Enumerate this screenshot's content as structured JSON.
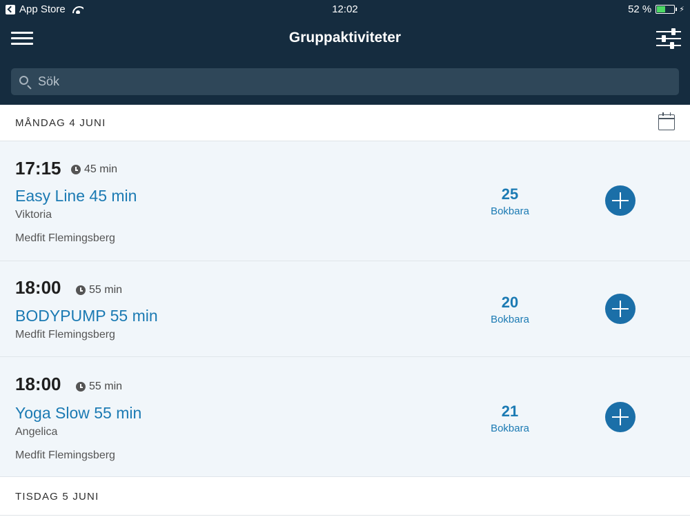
{
  "status_bar": {
    "carrier": "App Store",
    "time": "12:02",
    "battery": "52 %",
    "battery_level": 0.52
  },
  "header": {
    "title": "Gruppaktiviteter",
    "search_placeholder": "Sök",
    "menu_icon": "hamburger-icon",
    "filter_icon": "sliders-icon"
  },
  "days": [
    {
      "label": "MÅNDAG 4 JUNI",
      "activities": [
        {
          "time": "17:15",
          "duration": "45 min",
          "name": "Easy Line 45 min",
          "instructor": "Viktoria",
          "location": "Medfit Flemingsberg",
          "count": "25",
          "count_label": "Bokbara"
        },
        {
          "time": "18:00",
          "duration": "55 min",
          "name": "BODYPUMP 55 min",
          "location": "Medfit Flemingsberg",
          "count": "20",
          "count_label": "Bokbara"
        },
        {
          "time": "18:00",
          "duration": "55 min",
          "name": "Yoga Slow 55 min",
          "instructor": "Angelica",
          "location": "Medfit Flemingsberg",
          "count": "21",
          "count_label": "Bokbara"
        }
      ]
    },
    {
      "label": "TISDAG 5 JUNI",
      "activities": []
    }
  ],
  "colors": {
    "navbar": "#152c3f",
    "accent": "#1b7ab3",
    "card_bg": "#f1f6fa"
  }
}
